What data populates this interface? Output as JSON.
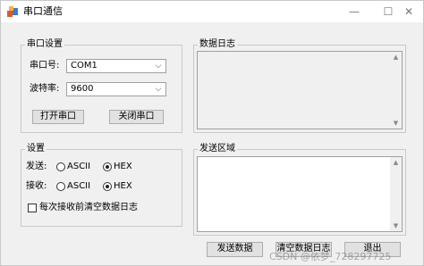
{
  "window": {
    "title": "串口通信",
    "minimize_glyph": "—",
    "maximize_glyph": "☐",
    "close_glyph": "✕"
  },
  "serial_settings": {
    "legend": "串口设置",
    "port_label": "串口号:",
    "port_value": "COM1",
    "baud_label": "波特率:",
    "baud_value": "9600",
    "open_button": "打开串口",
    "close_button": "关闭串口"
  },
  "settings": {
    "legend": "设置",
    "send_label": "发送:",
    "receive_label": "接收:",
    "ascii_label": "ASCII",
    "hex_label": "HEX",
    "send_mode_selected": "HEX",
    "receive_mode_selected": "HEX",
    "clear_log_checkbox_label": "每次接收前清空数据日志",
    "clear_log_checked": false
  },
  "data_log": {
    "legend": "数据日志",
    "content": ""
  },
  "send_area": {
    "legend": "发送区域",
    "content": ""
  },
  "actions": {
    "send_button": "发送数据",
    "clear_button": "清空数据日志",
    "exit_button": "退出"
  },
  "watermark": "CSDN @依梦_728297725",
  "colors": {
    "window_bg": "#f0f0f0",
    "titlebar_bg": "#ffffff",
    "button_bg": "#e1e1e1",
    "border": "#a0a0a0"
  },
  "icons": {
    "app": "app-icon",
    "combo_arrow": "chevron-down-icon",
    "scroll_up": "scroll-up-arrow-icon",
    "scroll_down": "scroll-down-arrow-icon"
  }
}
